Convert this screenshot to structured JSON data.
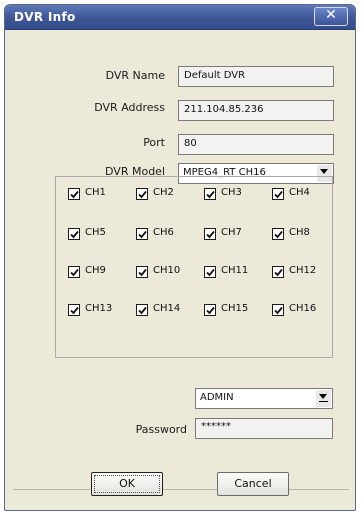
{
  "window": {
    "title": "DVR Info"
  },
  "form": {
    "dvr_name_label": "DVR Name",
    "dvr_name_value": "Default DVR",
    "dvr_address_label": "DVR Address",
    "dvr_address_value": "211.104.85.236",
    "port_label": "Port",
    "port_value": "80",
    "dvr_model_label": "DVR Model",
    "dvr_model_value": "MPEG4_RT CH16"
  },
  "channels": [
    {
      "label": "CH1",
      "checked": true
    },
    {
      "label": "CH2",
      "checked": true
    },
    {
      "label": "CH3",
      "checked": true
    },
    {
      "label": "CH4",
      "checked": true
    },
    {
      "label": "CH5",
      "checked": true
    },
    {
      "label": "CH6",
      "checked": true
    },
    {
      "label": "CH7",
      "checked": true
    },
    {
      "label": "CH8",
      "checked": true
    },
    {
      "label": "CH9",
      "checked": true
    },
    {
      "label": "CH10",
      "checked": true
    },
    {
      "label": "CH11",
      "checked": true
    },
    {
      "label": "CH12",
      "checked": true
    },
    {
      "label": "CH13",
      "checked": true
    },
    {
      "label": "CH14",
      "checked": true
    },
    {
      "label": "CH15",
      "checked": true
    },
    {
      "label": "CH16",
      "checked": true
    }
  ],
  "auth": {
    "user_value": "ADMIN",
    "password_label": "Password",
    "password_value": "******"
  },
  "buttons": {
    "ok": "OK",
    "cancel": "Cancel"
  }
}
